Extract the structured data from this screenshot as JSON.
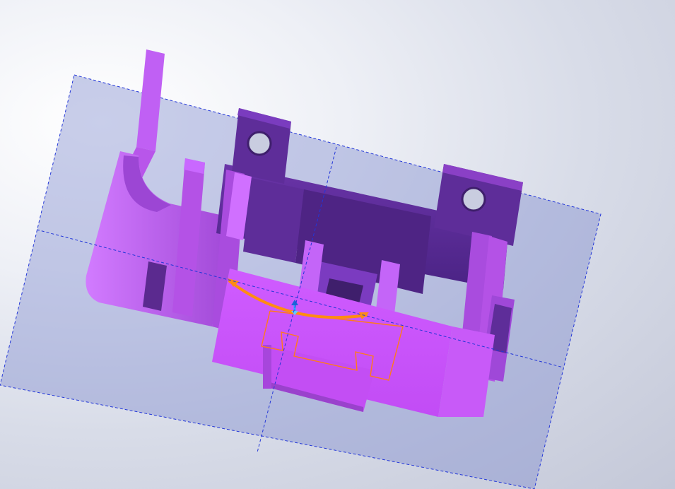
{
  "viewport": {
    "background_top": "#ffffff",
    "background_bottom": "#c4c8d8"
  },
  "model": {
    "part_color": "#c653f5",
    "part_color_light": "#d070ff",
    "part_color_mid": "#a844d8",
    "part_color_dark": "#5b2a8f",
    "part_color_shadow": "#3f1f6c",
    "sketch_color": "#ff7a1a",
    "plane_fill": "#8e97cf",
    "plane_edge": "#2236d8"
  },
  "icons": {
    "triad": "origin-triad-icon",
    "drag_arrow": "rotate-drag-arrow-icon"
  }
}
